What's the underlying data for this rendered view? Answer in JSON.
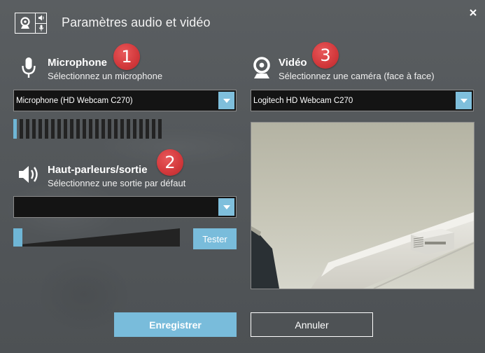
{
  "dialog": {
    "title": "Paramètres audio et vidéo",
    "close_icon": "close-icon"
  },
  "microphone": {
    "title": "Microphone",
    "subtitle": "Sélectionnez un microphone",
    "badge": "1",
    "icon": "microphone-icon",
    "selected": "Microphone (HD Webcam C270)",
    "level_bars_total": 24,
    "level_bars_active": 1
  },
  "speakers": {
    "title": "Haut-parleurs/sortie",
    "subtitle": "Sélectionnez une sortie par défaut",
    "badge": "2",
    "icon": "speaker-icon",
    "selected": "",
    "volume_fraction": 0,
    "test_label": "Tester"
  },
  "video": {
    "title": "Vidéo",
    "subtitle": "Sélectionnez une caméra (face à face)",
    "badge": "3",
    "icon": "webcam-icon",
    "selected": "Logitech HD Webcam C270"
  },
  "footer": {
    "save_label": "Enregistrer",
    "cancel_label": "Annuler"
  },
  "colors": {
    "accent": "#79bcdb",
    "badge_red": "#d43a3d",
    "background": "#55595c",
    "select_bg": "#141414"
  }
}
